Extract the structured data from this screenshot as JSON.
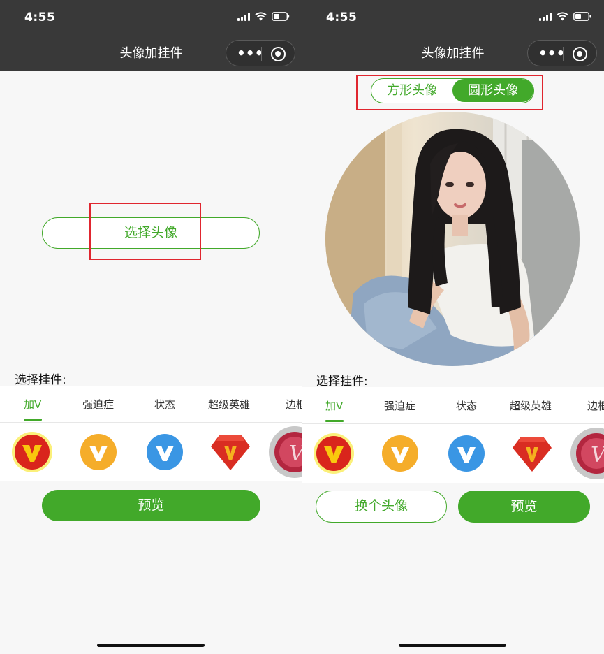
{
  "status_bar": {
    "time": "4:55"
  },
  "nav": {
    "title": "头像加挂件",
    "menu_dots": "•••"
  },
  "left": {
    "choose_avatar_label": "选择头像",
    "section_label": "选择挂件:",
    "tabs": [
      {
        "label": "加V",
        "active": true
      },
      {
        "label": "强迫症",
        "active": false
      },
      {
        "label": "状态",
        "active": false
      },
      {
        "label": "超级英雄",
        "active": false
      },
      {
        "label": "边框",
        "active": false
      }
    ],
    "stickers": [
      "red-v-badge-icon",
      "orange-v-badge-icon",
      "blue-v-badge-icon",
      "red-gem-v-badge-icon",
      "pink-v-badge-icon"
    ],
    "preview_label": "预览"
  },
  "right": {
    "shape_options": {
      "square": "方形头像",
      "circle": "圆形头像",
      "selected": "circle"
    },
    "section_label": "选择挂件:",
    "tabs": [
      {
        "label": "加V",
        "active": true
      },
      {
        "label": "强迫症",
        "active": false
      },
      {
        "label": "状态",
        "active": false
      },
      {
        "label": "超级英雄",
        "active": false
      },
      {
        "label": "边框",
        "active": false
      }
    ],
    "change_avatar_label": "换个头像",
    "preview_label": "预览"
  },
  "colors": {
    "accent": "#42a92a",
    "highlight": "#e0262f",
    "header": "#393939"
  }
}
